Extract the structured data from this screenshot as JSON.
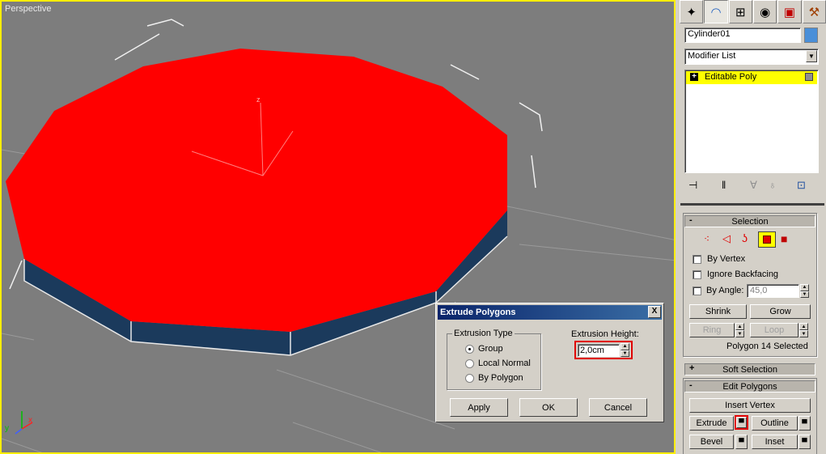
{
  "viewport": {
    "label": "Perspective",
    "gizmo_axis_z": "z",
    "mini_axes": {
      "y": "y",
      "x": "x"
    }
  },
  "command_panel": {
    "tabs": [
      {
        "name": "create-tab",
        "icon": "star-wand-icon"
      },
      {
        "name": "modify-tab",
        "icon": "bent-arc-icon",
        "active": true
      },
      {
        "name": "hierarchy-tab",
        "icon": "hierarchy-icon"
      },
      {
        "name": "motion-tab",
        "icon": "wheel-icon"
      },
      {
        "name": "display-tab",
        "icon": "monitor-icon"
      },
      {
        "name": "utilities-tab",
        "icon": "hammer-icon"
      }
    ],
    "object_name": "Cylinder01",
    "object_color": "#4a8fd8",
    "modifier_list_label": "Modifier List",
    "stack": [
      {
        "label": "Editable Poly",
        "expand": "+"
      }
    ],
    "selection": {
      "header": "Selection",
      "header_sign": "-",
      "levels": [
        "vertex-icon",
        "edge-icon",
        "border-icon",
        "polygon-icon",
        "element-icon"
      ],
      "active_level": "polygon-icon",
      "by_vertex": "By Vertex",
      "ignore_backfacing": "Ignore Backfacing",
      "by_angle": "By Angle:",
      "angle_value": "45,0",
      "shrink": "Shrink",
      "grow": "Grow",
      "ring": "Ring",
      "loop": "Loop",
      "status": "Polygon 14 Selected"
    },
    "soft_selection": {
      "header": "Soft Selection",
      "sign": "+"
    },
    "edit_polygons": {
      "header": "Edit Polygons",
      "sign": "-",
      "insert_vertex": "Insert Vertex",
      "extrude": "Extrude",
      "outline": "Outline",
      "bevel": "Bevel",
      "inset": "Inset"
    }
  },
  "dialog": {
    "title": "Extrude Polygons",
    "close": "X",
    "extrusion_type_label": "Extrusion Type",
    "options": [
      "Group",
      "Local Normal",
      "By Polygon"
    ],
    "selected_option": "Group",
    "height_label": "Extrusion Height:",
    "height_value": "2,0cm",
    "apply": "Apply",
    "ok": "OK",
    "cancel": "Cancel"
  },
  "colors": {
    "viewport_border": "#ffee00",
    "face": "#ff0000",
    "side": "#1b3a5c",
    "highlight": "#ffff00",
    "callout": "#e00000"
  }
}
